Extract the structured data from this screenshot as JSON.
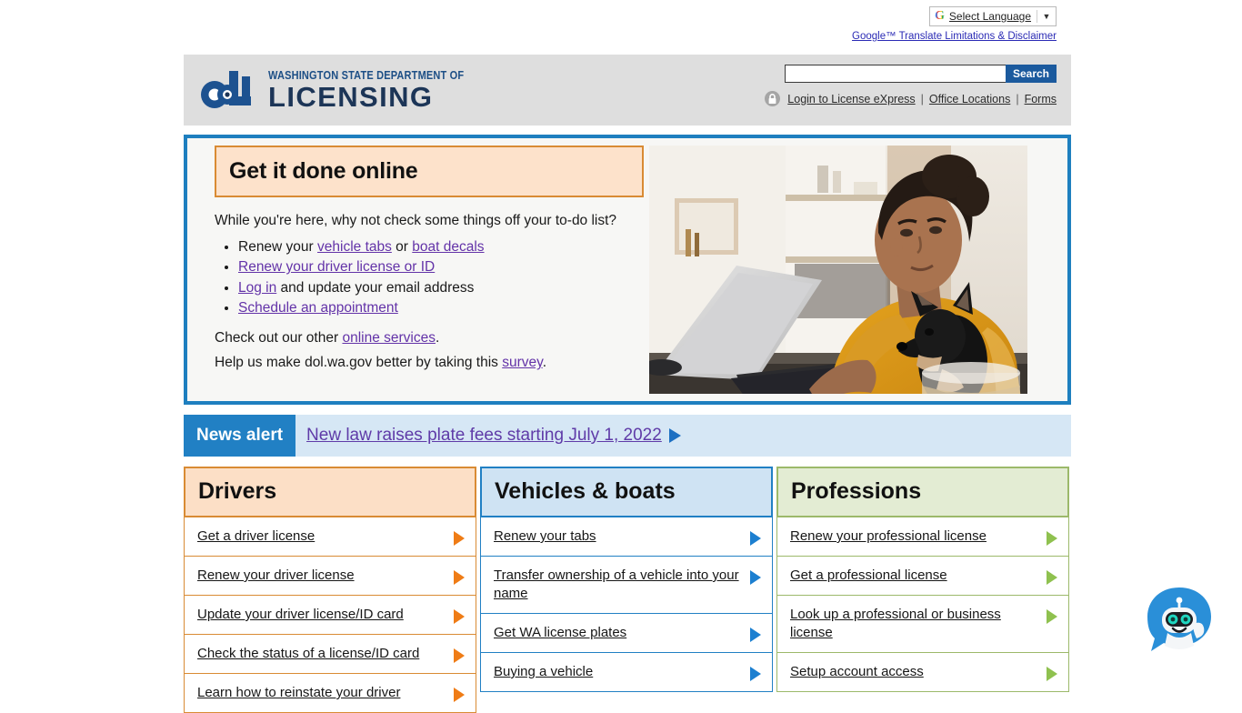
{
  "translate": {
    "google_logo": "G",
    "select_language": "Select Language",
    "caret": "▼",
    "disclaimer": "Google™ Translate Limitations & Disclaimer"
  },
  "header": {
    "logo": {
      "mark": "dL-monogram",
      "line1": "WASHINGTON STATE DEPARTMENT OF",
      "line2": "LICENSING"
    },
    "search": {
      "value": "",
      "placeholder": "",
      "button_label": "Search"
    },
    "links": [
      {
        "label": "Login to License eXpress",
        "icon": "lock-icon"
      },
      {
        "label": "Office Locations"
      },
      {
        "label": "Forms"
      }
    ],
    "separator": "|"
  },
  "hero": {
    "title": "Get it done online",
    "intro": "While you're here, why not check some things off your to-do list?",
    "bullets": [
      {
        "prefix": "Renew your ",
        "link1": "vehicle tabs",
        "middle": " or ",
        "link2": "boat decals",
        "suffix": ""
      },
      {
        "prefix": "",
        "link1": "Renew your driver license or ID",
        "middle": "",
        "link2": "",
        "suffix": ""
      },
      {
        "prefix": "",
        "link1": "Log in",
        "middle": "",
        "link2": "",
        "suffix": " and update your email address"
      },
      {
        "prefix": "",
        "link1": "Schedule an appointment",
        "middle": "",
        "link2": "",
        "suffix": ""
      }
    ],
    "other_services_prefix": "Check out our other ",
    "other_services_link": "online services",
    "other_services_suffix": ".",
    "survey_prefix": "Help us make dol.wa.gov better by taking this ",
    "survey_link": "survey",
    "survey_suffix": ".",
    "image_alt": "Woman in an orange sweater holding a small black dog while typing on a laptop"
  },
  "news_alert": {
    "label": "News alert",
    "link": "New law raises plate fees starting July 1, 2022",
    "arrow": "play-triangle-icon"
  },
  "columns": [
    {
      "key": "drivers",
      "title": "Drivers",
      "accent": "#d98b34",
      "header_bg": "#fcdfc6",
      "arrow_color": "#ef7c16",
      "items": [
        "Get a driver license",
        "Renew your driver license",
        "Update your driver license/ID card",
        "Check the status of a license/ID card",
        "Learn how to reinstate your driver"
      ]
    },
    {
      "key": "vehicles",
      "title": "Vehicles & boats",
      "accent": "#2180c4",
      "header_bg": "#cfe3f3",
      "arrow_color": "#1c7fd0",
      "items": [
        "Renew your tabs",
        "Transfer ownership of a vehicle into your name",
        "Get WA license plates",
        "Buying a vehicle"
      ]
    },
    {
      "key": "professions",
      "title": "Professions",
      "accent": "#9cb96a",
      "header_bg": "#e3ecd3",
      "arrow_color": "#8fc14f",
      "items": [
        "Renew your professional license",
        "Get a professional license",
        "Look up a professional or business license",
        "Setup account access"
      ]
    }
  ],
  "chatbot": {
    "icon": "chatbot-robot-icon",
    "bubble_color": "#2a8fd8",
    "eye_color": "#1fd6c0"
  }
}
